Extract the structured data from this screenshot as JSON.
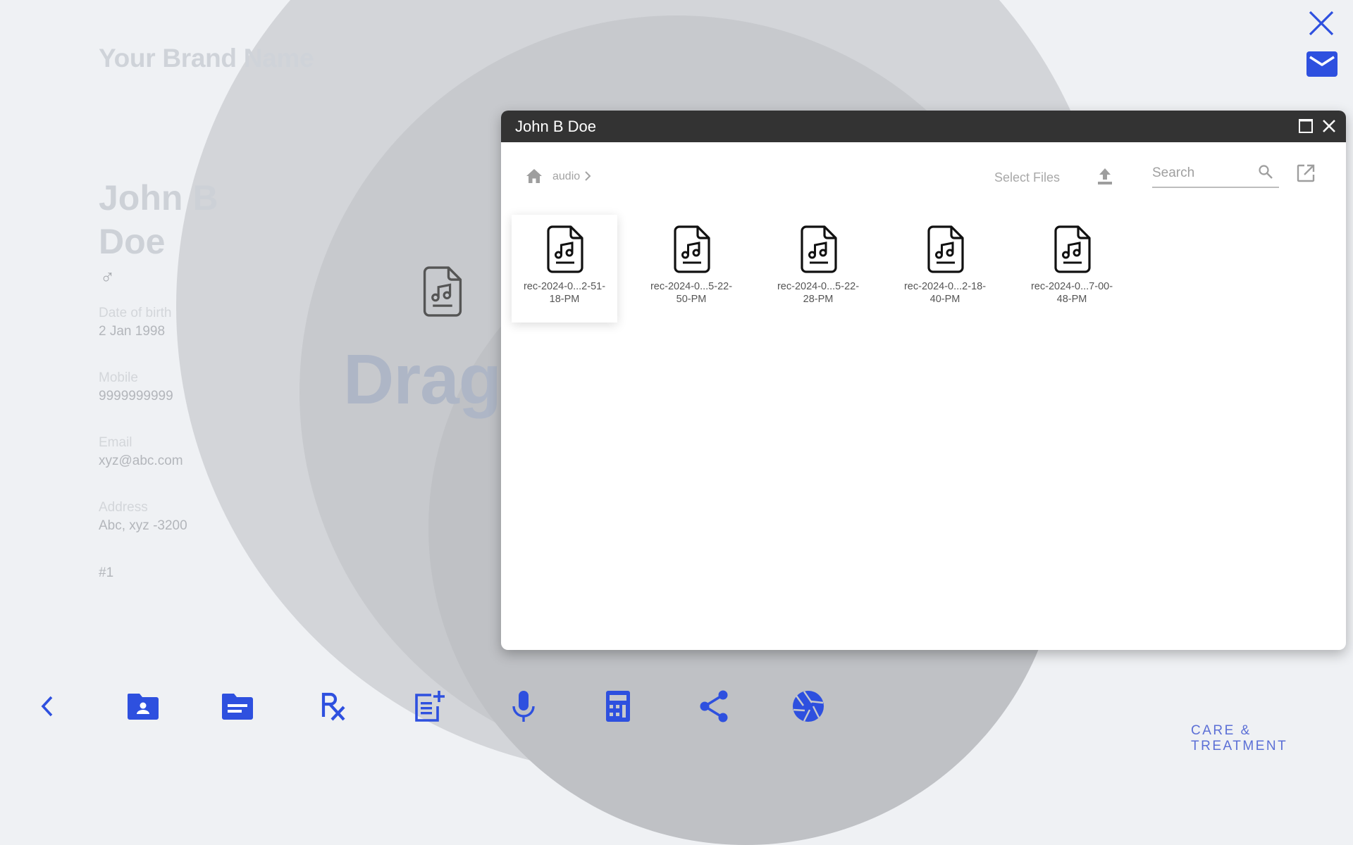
{
  "app": {
    "brand_name": "Your Brand Name",
    "footer_label": "CARE & TREATMENT",
    "accent_color": "#2e50df"
  },
  "patient": {
    "name": "John B Doe",
    "gender_icon": "male-symbol",
    "fields": [
      {
        "label": "Date of birth",
        "value": "2 Jan 1998"
      },
      {
        "label": "Mobile",
        "value": "9999999999"
      },
      {
        "label": "Email",
        "value": "xyz@abc.com"
      },
      {
        "label": "Address",
        "value": "Abc, xyz -3200"
      }
    ],
    "record_index": "#1"
  },
  "drag_overlay": {
    "text": "Drag",
    "icon": "audio-file-icon"
  },
  "top_actions": [
    {
      "name": "close",
      "icon": "close-icon"
    },
    {
      "name": "mail",
      "icon": "mail-icon"
    }
  ],
  "dialog": {
    "title": "John B Doe",
    "breadcrumb": {
      "home_icon": "home-icon",
      "items": [
        "audio"
      ]
    },
    "select_files_label": "Select Files",
    "search": {
      "placeholder": "Search",
      "value": ""
    },
    "files": [
      {
        "name_line1": "rec-2024-0...2-51-",
        "name_line2": "18-PM",
        "selected": true
      },
      {
        "name_line1": "rec-2024-0...5-22-",
        "name_line2": "50-PM",
        "selected": false
      },
      {
        "name_line1": "rec-2024-0...5-22-",
        "name_line2": "28-PM",
        "selected": false
      },
      {
        "name_line1": "rec-2024-0...2-18-",
        "name_line2": "40-PM",
        "selected": false
      },
      {
        "name_line1": "rec-2024-0...7-00-",
        "name_line2": "48-PM",
        "selected": false
      }
    ]
  },
  "bottom_toolbar": [
    {
      "name": "back",
      "icon": "chevron-left-icon"
    },
    {
      "name": "patient-folder",
      "icon": "folder-shared-icon"
    },
    {
      "name": "documents-folder",
      "icon": "folder-notes-icon"
    },
    {
      "name": "prescription",
      "icon": "rx-icon"
    },
    {
      "name": "add-note",
      "icon": "post-add-icon"
    },
    {
      "name": "record-audio",
      "icon": "microphone-icon"
    },
    {
      "name": "calculator",
      "icon": "calculator-icon"
    },
    {
      "name": "share",
      "icon": "share-icon"
    },
    {
      "name": "camera",
      "icon": "camera-shutter-icon"
    }
  ]
}
